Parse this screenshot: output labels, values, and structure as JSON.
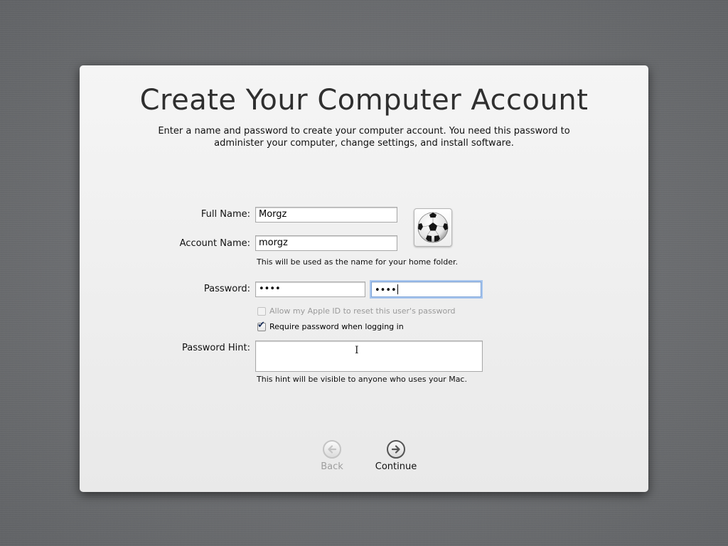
{
  "page": {
    "title": "Create Your Computer Account",
    "subtitle": "Enter a name and password to create your computer account. You need this password to administer your computer, change settings, and install software."
  },
  "form": {
    "full_name_label": "Full Name:",
    "full_name_value": "Morgz",
    "account_name_label": "Account Name:",
    "account_name_value": "morgz",
    "account_name_note": "This will be used as the name for your home folder.",
    "password_label": "Password:",
    "password_value": "••••",
    "verify_value": "••••",
    "apple_id_reset_label": "Allow my Apple ID to reset this user's password",
    "apple_id_reset_checked": false,
    "apple_id_reset_enabled": false,
    "require_password_label": "Require password when logging in",
    "require_password_checked": true,
    "hint_label": "Password Hint:",
    "hint_value": "",
    "hint_note": "This hint will be visible to anyone who uses your Mac."
  },
  "avatar": {
    "icon": "soccer-ball-icon"
  },
  "nav": {
    "back_label": "Back",
    "back_enabled": false,
    "continue_label": "Continue",
    "continue_enabled": true
  }
}
